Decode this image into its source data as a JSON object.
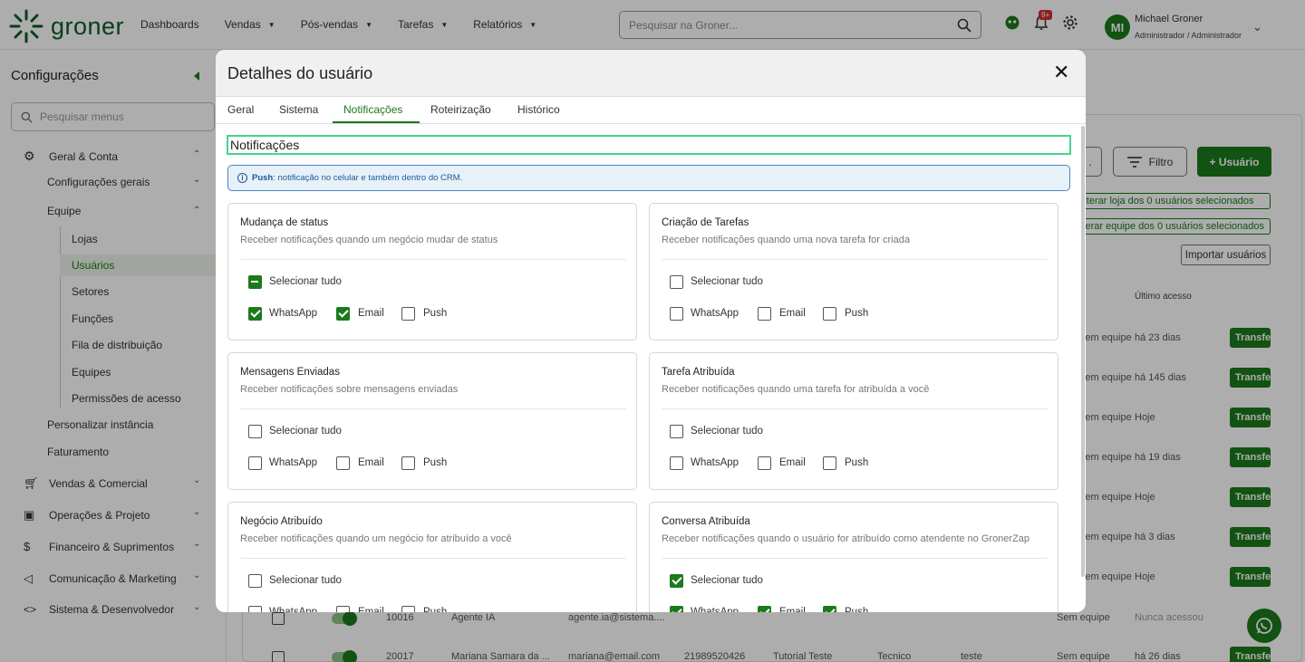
{
  "brand": {
    "name": "groner",
    "color": "#1b7a1b"
  },
  "topnav": {
    "items": [
      {
        "label": "Dashboards",
        "caret": false
      },
      {
        "label": "Vendas",
        "caret": true
      },
      {
        "label": "Pós-vendas",
        "caret": true
      },
      {
        "label": "Tarefas",
        "caret": true
      },
      {
        "label": "Relatórios",
        "caret": true
      }
    ],
    "search_placeholder": "Pesquisar na Groner...",
    "notif_badge": "9+"
  },
  "user": {
    "initials": "MI",
    "name": "Michael Groner",
    "role": "Administrador / Administrador"
  },
  "sidebar": {
    "title": "Configurações",
    "search_placeholder": "Pesquisar menus",
    "geral": "Geral & Conta",
    "config_gerais": "Configurações gerais",
    "equipe": "Equipe",
    "equipe_items": [
      "Lojas",
      "Usuários",
      "Setores",
      "Funções",
      "Fila de distribuição",
      "Equipes",
      "Permissões de acesso"
    ],
    "personalizar": "Personalizar instância",
    "faturamento": "Faturamento",
    "sections": [
      "Vendas & Comercial",
      "Operações & Projeto",
      "Financeiro & Suprimentos",
      "Comunicação & Marketing",
      "Sistema & Desenvolvedor"
    ]
  },
  "background": {
    "filter_label": "Filtro",
    "add_user_label": "+ Usuário",
    "alter_loja": "Alterar loja dos 0 usuários selecionados",
    "alter_equipe": "Alterar equipe dos 0 usuários selecionados",
    "import_label": "Importar usuários",
    "last_access_header": "Último acesso",
    "transfer_label": "Transferir",
    "rows": [
      {
        "team": "Sem equipe",
        "last": "há 23 dias"
      },
      {
        "team": "Sem equipe",
        "last": "há 145 dias"
      },
      {
        "team": "Sem equipe",
        "last": "Hoje"
      },
      {
        "team": "Sem equipe",
        "last": "há 19 dias"
      },
      {
        "team": "Sem equipe",
        "last": "Hoje"
      },
      {
        "team": "Sem equipe",
        "last": "há 3 dias"
      },
      {
        "team": "Sem equipe",
        "last": "Hoje"
      }
    ],
    "row_a": {
      "id": "10016",
      "name": "Agente IA",
      "email": "agente.ia@sistema....",
      "team": "Sem equipe",
      "last": "Nunca acessou"
    },
    "row_b": {
      "id": "20017",
      "name": "Mariana Samara da ...",
      "email": "mariana@email.com",
      "phone": "21989520426",
      "store": "Tutorial Teste",
      "func": "Tecnico",
      "setor": "teste",
      "team": "Sem equipe",
      "last": "há 26 dias"
    }
  },
  "modal": {
    "title": "Detalhes do usuário",
    "tabs": [
      "Geral",
      "Sistema",
      "Notificações",
      "Roteirização",
      "Histórico"
    ],
    "active_tab": 2,
    "section_title": "Notificações",
    "info": {
      "bold": "Push",
      "text": ": notificação no celular e também dentro do CRM."
    },
    "select_all_label": "Selecionar tudo",
    "channels": [
      "WhatsApp",
      "Email",
      "Push"
    ],
    "cards": [
      {
        "title": "Mudança de status",
        "desc": "Receber notificações quando um negócio mudar de status",
        "select_all": "indeterminate",
        "checks": [
          true,
          true,
          false
        ]
      },
      {
        "title": "Criação de Tarefas",
        "desc": "Receber notificações quando uma nova tarefa for criada",
        "select_all": "off",
        "checks": [
          false,
          false,
          false
        ]
      },
      {
        "title": "Mensagens Enviadas",
        "desc": "Receber notificações sobre mensagens enviadas",
        "select_all": "off",
        "checks": [
          false,
          false,
          false
        ]
      },
      {
        "title": "Tarefa Atribuída",
        "desc": "Receber notificações quando uma tarefa for atribuída a você",
        "select_all": "off",
        "checks": [
          false,
          false,
          false
        ]
      },
      {
        "title": "Negócio Atribuído",
        "desc": "Receber notificações quando um negócio for atribuído a você",
        "select_all": "off",
        "checks": [
          false,
          false,
          false
        ]
      },
      {
        "title": "Conversa Atribuída",
        "desc": "Receber notificações quando o usuário for atribuído como atendente no GronerZap",
        "select_all": "on",
        "checks": [
          true,
          true,
          true
        ]
      }
    ]
  }
}
